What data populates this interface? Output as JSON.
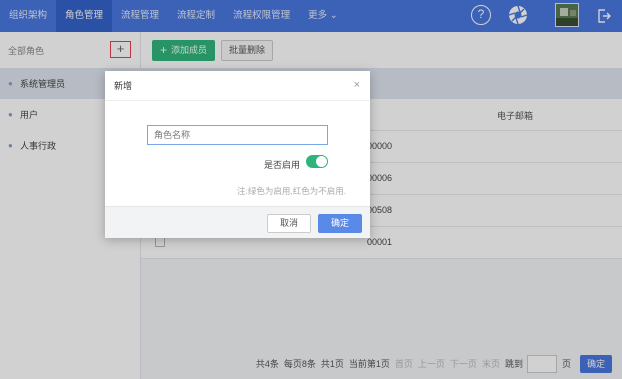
{
  "nav": {
    "items": [
      {
        "label": "组织架构",
        "active": false
      },
      {
        "label": "角色管理",
        "active": true
      },
      {
        "label": "流程管理",
        "active": false
      },
      {
        "label": "流程定制",
        "active": false
      },
      {
        "label": "流程权限管理",
        "active": false
      }
    ],
    "more_label": "更多",
    "icons": [
      "help-icon",
      "aperture-icon",
      "avatar",
      "logout-icon"
    ]
  },
  "sidebar": {
    "header": "全部角色",
    "add_symbol": "+",
    "items": [
      {
        "label": "系统管理员",
        "active": true
      },
      {
        "label": "用户",
        "active": false
      },
      {
        "label": "人事行政",
        "active": false
      }
    ]
  },
  "toolbar": {
    "add_member_label": "添加成员",
    "batch_delete_label": "批量删除"
  },
  "table": {
    "email_header": "电子邮箱",
    "rows": [
      "00000",
      "00006",
      "00508",
      "00001"
    ]
  },
  "pager": {
    "total": "共4条",
    "per_page": "每页8条",
    "pages": "共1页",
    "current": "当前第1页",
    "first": "首页",
    "prev": "上一页",
    "next": "下一页",
    "last": "末页",
    "goto": "跳到",
    "page_unit": "页",
    "confirm": "确定"
  },
  "modal": {
    "title": "新增",
    "close": "×",
    "role_name_placeholder": "角色名称",
    "enable_label": "是否启用",
    "enabled": true,
    "hint": "注:绿色为启用,红色为不启用.",
    "cancel": "取消",
    "ok": "确定"
  },
  "colors": {
    "nav_bg": "#4a78e0",
    "accent_green": "#2fb57a",
    "highlight_red": "#e8424b"
  }
}
